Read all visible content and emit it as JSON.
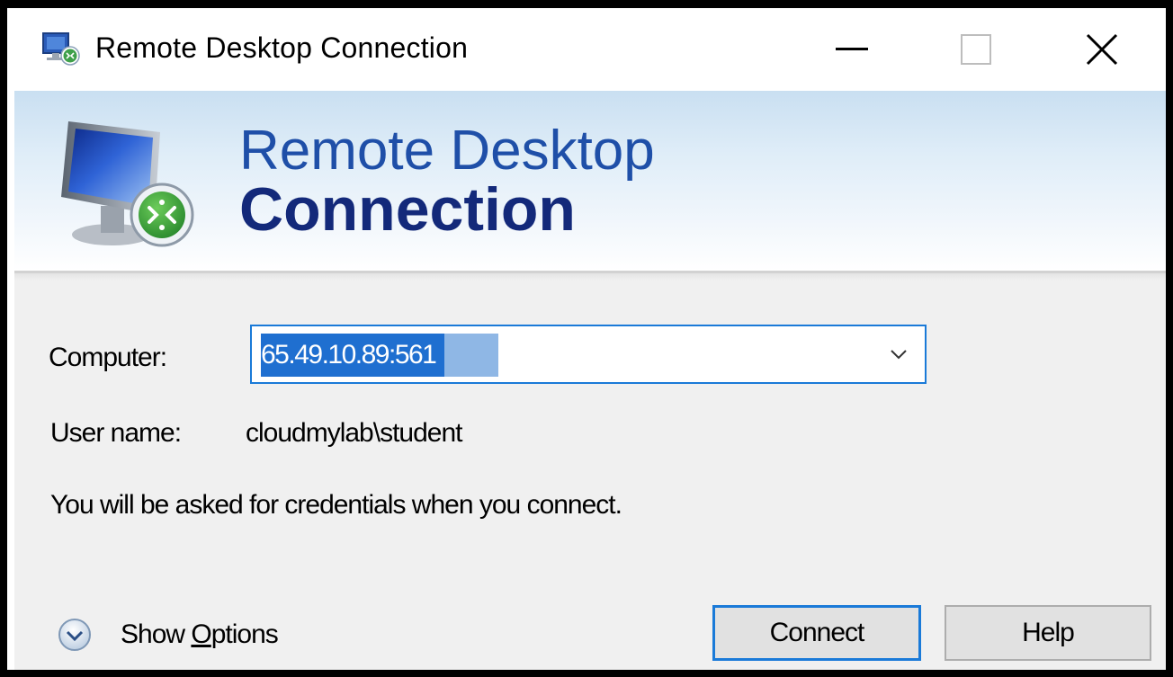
{
  "window": {
    "title": "Remote Desktop Connection",
    "minimize_glyph": "—",
    "maximize_glyph": "☐",
    "close_glyph": "✕"
  },
  "banner": {
    "line1": "Remote Desktop",
    "line2": "Connection"
  },
  "form": {
    "computer_label": "Computer:",
    "computer_value": "65.49.10.89:561",
    "user_label": "User name:",
    "user_value": "cloudmylab\\student",
    "info_text": "You will be asked for credentials when you connect."
  },
  "footer": {
    "show_options_prefix": "Show ",
    "show_options_mnemonic": "O",
    "show_options_suffix": "ptions",
    "connect_label": "Connect",
    "help_label": "Help"
  },
  "colors": {
    "accent": "#1a7ad8",
    "selection": "#1f6fd0",
    "banner_title": "#13297a"
  },
  "icons": {
    "app": "remote-desktop-icon",
    "banner": "monitor-connection-icon",
    "dropdown": "chevron-down-icon",
    "options": "expand-circle-icon"
  }
}
